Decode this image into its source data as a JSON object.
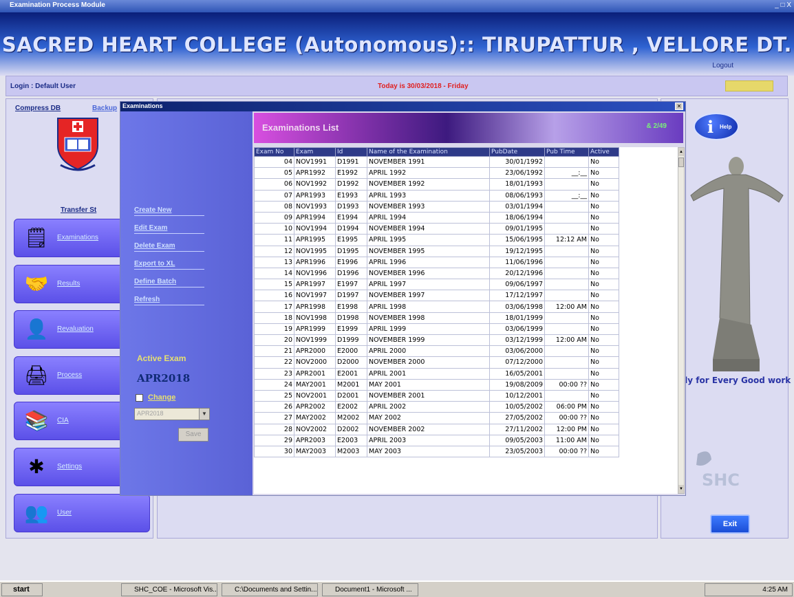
{
  "window": {
    "title": "Examination Process Module",
    "controls": "_ □ X"
  },
  "app": {
    "title": "SACRED HEART COLLEGE (Autonomous):: TIRUPATTUR , VELLORE DT.",
    "logout": "Logout",
    "login": "Login : Default User",
    "today": "Today is 30/03/2018 - Friday"
  },
  "links": {
    "compress": "Compress DB",
    "backup": "Backup",
    "transfer": "Transfer St"
  },
  "nav": [
    {
      "label": "Examinations",
      "icon": "document-icon"
    },
    {
      "label": "Results",
      "icon": "handshake-icon"
    },
    {
      "label": "Revaluation",
      "icon": "user-icon"
    },
    {
      "label": "Process",
      "icon": "printer-icon"
    },
    {
      "label": "CIA",
      "icon": "books-icon"
    },
    {
      "label": "Settings",
      "icon": "tools-icon"
    },
    {
      "label": "User",
      "icon": "people-icon"
    }
  ],
  "right": {
    "help": "Help",
    "motto": "dy for Every Good work",
    "logo_text": "SHC",
    "exit": "Exit"
  },
  "dialog": {
    "title": "Examinations",
    "list_title": "Examinations List",
    "count": "& 2/49",
    "actions": [
      "Create New",
      "Edit Exam",
      "Delete Exam",
      "Export to XL",
      "Define Batch",
      "Refresh"
    ],
    "active_label": "Active Exam",
    "active_value": "APR2018",
    "change_label": "Change",
    "select_value": "APR2018",
    "save": "Save"
  },
  "table": {
    "columns": [
      "Exam No",
      "Exam",
      "Id",
      "Name of the Examination",
      "PubDate",
      "Pub Time",
      "Active"
    ],
    "rows": [
      [
        "04",
        "NOV1991",
        "D1991",
        "NOVEMBER 1991",
        "30/01/1992",
        "",
        "No"
      ],
      [
        "05",
        "APR1992",
        "E1992",
        "APRIL 1992",
        "23/06/1992",
        "__:__",
        "No"
      ],
      [
        "06",
        "NOV1992",
        "D1992",
        "NOVEMBER 1992",
        "18/01/1993",
        "",
        "No"
      ],
      [
        "07",
        "APR1993",
        "E1993",
        "APRIL 1993",
        "08/06/1993",
        "__:__",
        "No"
      ],
      [
        "08",
        "NOV1993",
        "D1993",
        "NOVEMBER 1993",
        "03/01/1994",
        "",
        "No"
      ],
      [
        "09",
        "APR1994",
        "E1994",
        "APRIL 1994",
        "18/06/1994",
        "",
        "No"
      ],
      [
        "10",
        "NOV1994",
        "D1994",
        "NOVEMBER 1994",
        "09/01/1995",
        "",
        "No"
      ],
      [
        "11",
        "APR1995",
        "E1995",
        "APRIL 1995",
        "15/06/1995",
        "12:12 AM",
        "No"
      ],
      [
        "12",
        "NOV1995",
        "D1995",
        "NOVEMBER 1995",
        "19/12/1995",
        "",
        "No"
      ],
      [
        "13",
        "APR1996",
        "E1996",
        "APRIL 1996",
        "11/06/1996",
        "",
        "No"
      ],
      [
        "14",
        "NOV1996",
        "D1996",
        "NOVEMBER 1996",
        "20/12/1996",
        "",
        "No"
      ],
      [
        "15",
        "APR1997",
        "E1997",
        "APRIL 1997",
        "09/06/1997",
        "",
        "No"
      ],
      [
        "16",
        "NOV1997",
        "D1997",
        "NOVEMBER 1997",
        "17/12/1997",
        "",
        "No"
      ],
      [
        "17",
        "APR1998",
        "E1998",
        "APRIL 1998",
        "03/06/1998",
        "12:00 AM",
        "No"
      ],
      [
        "18",
        "NOV1998",
        "D1998",
        "NOVEMBER 1998",
        "18/01/1999",
        "",
        "No"
      ],
      [
        "19",
        "APR1999",
        "E1999",
        "APRIL 1999",
        "03/06/1999",
        "",
        "No"
      ],
      [
        "20",
        "NOV1999",
        "D1999",
        "NOVEMBER 1999",
        "03/12/1999",
        "12:00 AM",
        "No"
      ],
      [
        "21",
        "APR2000",
        "E2000",
        "APRIL 2000",
        "03/06/2000",
        "",
        "No"
      ],
      [
        "22",
        "NOV2000",
        "D2000",
        "NOVEMBER 2000",
        "07/12/2000",
        "",
        "No"
      ],
      [
        "23",
        "APR2001",
        "E2001",
        "APRIL 2001",
        "16/05/2001",
        "",
        "No"
      ],
      [
        "24",
        "MAY2001",
        "M2001",
        "MAY 2001",
        "19/08/2009",
        "00:00 ??",
        "No"
      ],
      [
        "25",
        "NOV2001",
        "D2001",
        "NOVEMBER 2001",
        "10/12/2001",
        "",
        "No"
      ],
      [
        "26",
        "APR2002",
        "E2002",
        "APRIL 2002",
        "10/05/2002",
        "06:00 PM",
        "No"
      ],
      [
        "27",
        "MAY2002",
        "M2002",
        "MAY 2002",
        "27/05/2002",
        "00:00 ??",
        "No"
      ],
      [
        "28",
        "NOV2002",
        "D2002",
        "NOVEMBER 2002",
        "27/11/2002",
        "12:00 PM",
        "No"
      ],
      [
        "29",
        "APR2003",
        "E2003",
        "APRIL 2003",
        "09/05/2003",
        "11:00 AM",
        "No"
      ],
      [
        "30",
        "MAY2003",
        "M2003",
        "MAY 2003",
        "23/05/2003",
        "00:00 ??",
        "No"
      ]
    ]
  },
  "taskbar": {
    "start": "start",
    "items": [
      "SHC_COE - Microsoft Vis...",
      "C:\\Documents and Settin...",
      "Document1 - Microsoft ..."
    ],
    "clock": "4:25 AM"
  }
}
